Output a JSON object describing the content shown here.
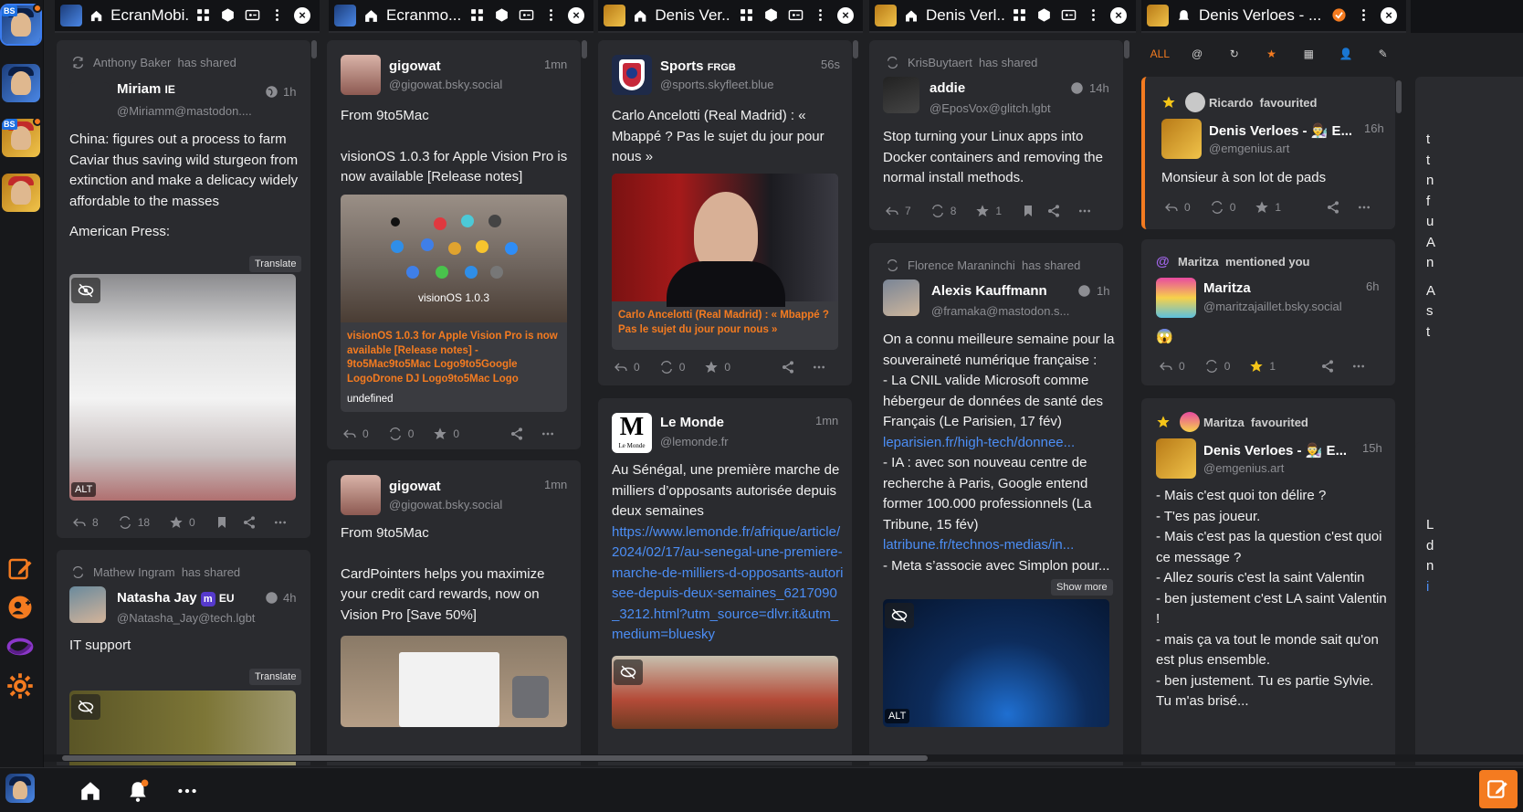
{
  "columns": [
    {
      "title": "EcranMobi...",
      "close": "×"
    },
    {
      "title": "Ecranmo...",
      "close": "×"
    },
    {
      "title": "Denis Ver...",
      "close": "×"
    },
    {
      "title": "Denis Verl...",
      "close": "×"
    },
    {
      "title": "Denis Verloes - ...",
      "close": "×"
    }
  ],
  "rail": {
    "badge": "BS"
  },
  "col1": {
    "post1": {
      "shared_by": "Anthony Baker",
      "shared_suffix": "has shared",
      "name": "Miriam",
      "name_tag": "IE",
      "handle": "@Miriamm@mastodon....",
      "time": "1h",
      "para1": "China: figures out a process to farm Caviar thus saving wild sturgeon from extinction and make a delicacy widely affordable to the masses",
      "para2": "American Press:",
      "translate": "Translate",
      "alt": "ALT",
      "replies": "8",
      "boosts": "18",
      "favs": "0"
    },
    "post2": {
      "shared_by": "Mathew Ingram",
      "shared_suffix": "has shared",
      "name": "Natasha Jay",
      "name_tag": "EU",
      "handle": "@Natasha_Jay@tech.lgbt",
      "time": "4h",
      "text": "IT support",
      "translate": "Translate"
    }
  },
  "col2": {
    "post1": {
      "name": "gigowat",
      "handle": "@gigowat.bsky.social",
      "time": "1mn",
      "line1": "From 9to5Mac",
      "line2": "visionOS 1.0.3 for Apple Vision Pro is now available [Release notes]",
      "media_label": "visionOS 1.0.3",
      "card_title": "visionOS 1.0.3 for Apple Vision Pro is now available [Release notes] - 9to5Mac9to5Mac Logo9to5Google LogoDrone DJ Logo9to5Mac Logo",
      "card_desc": "undefined",
      "replies": "0",
      "boosts": "0",
      "favs": "0"
    },
    "post2": {
      "name": "gigowat",
      "handle": "@gigowat.bsky.social",
      "time": "1mn",
      "line1": "From 9to5Mac",
      "line2": "CardPointers helps you maximize your credit card rewards, now on Vision Pro [Save 50%]"
    }
  },
  "col3": {
    "post1": {
      "name": "Sports",
      "name_tag": "FRGB",
      "handle": "@sports.skyfleet.blue",
      "time": "56s",
      "text": "Carlo Ancelotti (Real Madrid) : « Mbappé ? Pas le sujet du jour pour nous »",
      "card_title": "Carlo Ancelotti (Real Madrid) : « Mbappé ? Pas le sujet du jour pour nous »",
      "replies": "0",
      "boosts": "0",
      "favs": "0"
    },
    "post2": {
      "name": "Le Monde",
      "handle": "@lemonde.fr",
      "time": "1mn",
      "logo": "M",
      "logo_sub": "Le Monde",
      "text": "Au Sénégal, une première marche de milliers d’opposants autorisée depuis deux semaines",
      "link": "https://www.lemonde.fr/afrique/article/2024/02/17/au-senegal-une-premiere-marche-de-milliers-d-opposants-autorisee-depuis-deux-semaines_6217090_3212.html?utm_source=dlvr.it&utm_medium=bluesky"
    }
  },
  "col4": {
    "post1": {
      "shared_by": "KrisBuytaert",
      "shared_suffix": "has shared",
      "name": "addie",
      "handle": "@EposVox@glitch.lgbt",
      "time": "14h",
      "text": "Stop turning your Linux apps into Docker containers and removing the normal install methods.",
      "replies": "7",
      "boosts": "8",
      "favs": "1"
    },
    "post2": {
      "shared_by": "Florence Maraninchi",
      "shared_suffix": "has shared",
      "name": "Alexis Kauffmann",
      "handle": "@framaka@mastodon.s...",
      "time": "1h",
      "l1": "On a connu meilleure semaine pour la souveraineté numérique française :",
      "l2": "- La CNIL valide Microsoft comme hébergeur de données de santé des Français (Le Parisien, 17 fév)",
      "l3": "leparisien.fr/high-tech/donnee...",
      "l4": "- IA : avec son nouveau centre de recherche à Paris, Google entend former 100.000 professionnels (La Tribune, 15 fév)",
      "l5": "latribune.fr/technos-medias/in...",
      "l6": "- Meta s’associe avec Simplon pour...",
      "show_more": "Show more",
      "alt": "ALT"
    }
  },
  "col5": {
    "tabs": [
      "ALL",
      "@",
      "↻",
      "★",
      "▦",
      "👤",
      "✎"
    ],
    "n1": {
      "who": "Ricardo",
      "what": "favourited",
      "name": "Denis Verloes - 👨‍🔬 E...",
      "handle": "@emgenius.art",
      "time": "16h",
      "text": "Monsieur à son lot de pads",
      "replies": "0",
      "boosts": "0",
      "favs": "1"
    },
    "n2": {
      "who": "Maritza",
      "what": "mentioned you",
      "name": "Maritza",
      "handle": "@maritzajaillet.bsky.social",
      "time": "6h",
      "text": "😱",
      "replies": "0",
      "boosts": "0",
      "favs": "1"
    },
    "n3": {
      "who": "Maritza",
      "what": "favourited",
      "name": "Denis Verloes - 👨‍🔬 E...",
      "handle": "@emgenius.art",
      "time": "15h",
      "lines": [
        "- Mais c'est quoi ton délire ?",
        "- T'es pas joueur.",
        "- Mais c'est pas la question c'est quoi ce message ?",
        "- Allez souris c'est la saint Valentin",
        "- ben justement c'est LA saint Valentin !",
        "- mais ça va tout le monde sait qu'on est plus ensemble.",
        "- ben justement. Tu es partie Sylvie. Tu m'as brisé..."
      ]
    }
  },
  "col6": {
    "snippets": [
      "t",
      "t",
      "n",
      "f",
      "u",
      "A",
      "n",
      "A",
      "s",
      "t",
      "L",
      "d",
      "n",
      "i"
    ]
  }
}
